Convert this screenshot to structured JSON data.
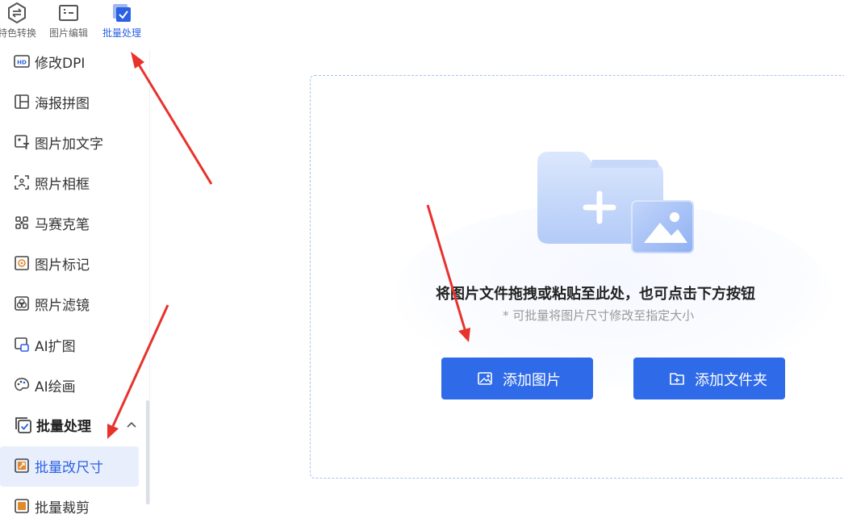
{
  "top_tabs": [
    {
      "label": "特色转换"
    },
    {
      "label": "图片编辑"
    },
    {
      "label": "批量处理"
    }
  ],
  "sidebar": {
    "items": [
      {
        "label": "修改DPI",
        "icon": "hd-icon"
      },
      {
        "label": "海报拼图",
        "icon": "collage-icon"
      },
      {
        "label": "图片加文字",
        "icon": "image-text-icon"
      },
      {
        "label": "照片相框",
        "icon": "photo-frame-icon"
      },
      {
        "label": "马赛克笔",
        "icon": "mosaic-icon"
      },
      {
        "label": "图片标记",
        "icon": "image-mark-icon"
      },
      {
        "label": "照片滤镜",
        "icon": "filter-icon"
      },
      {
        "label": "AI扩图",
        "icon": "ai-expand-icon"
      },
      {
        "label": "AI绘画",
        "icon": "palette-icon"
      }
    ],
    "group": {
      "label": "批量处理",
      "icon": "batch-check-icon"
    },
    "sub_items": [
      {
        "label": "批量改尺寸",
        "icon": "resize-icon"
      },
      {
        "label": "批量裁剪",
        "icon": "crop-icon"
      }
    ]
  },
  "dropzone": {
    "title": "将图片文件拖拽或粘贴至此处，也可点击下方按钮",
    "subtitle": "* 可批量将图片尺寸修改至指定大小",
    "add_image_label": "添加图片",
    "add_folder_label": "添加文件夹"
  },
  "colors": {
    "accent": "#2f6be8",
    "selected_bg": "#e8eefc",
    "annotation_red": "#e8322c"
  }
}
